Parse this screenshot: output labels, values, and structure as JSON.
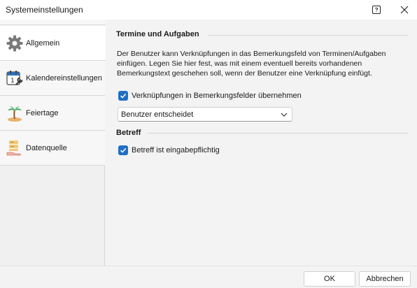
{
  "window": {
    "title": "Systemeinstellungen",
    "help_icon": "help-icon",
    "close_icon": "close-icon"
  },
  "sidebar": {
    "items": [
      {
        "label": "Allgemein",
        "icon": "gear-icon",
        "active": true
      },
      {
        "label": "Kalendereinstellungen",
        "icon": "calendar-wrench-icon",
        "active": false
      },
      {
        "label": "Feiertage",
        "icon": "palm-island-icon",
        "active": false
      },
      {
        "label": "Datenquelle",
        "icon": "database-hand-icon",
        "active": false
      }
    ]
  },
  "main": {
    "section1": {
      "title": "Termine und Aufgaben",
      "description_lines": [
        "Der Benutzer kann Verknüpfungen in das Bemerkungsfeld von Terminen/Aufgaben",
        "einfügen. Legen Sie hier fest, was mit einem eventuell bereits vorhandenen",
        "Bemerkungstext geschehen soll, wenn der Benutzer eine Verknüpfung einfügt."
      ],
      "checkbox_label": "Verknüpfungen in Bemerkungsfelder übernehmen",
      "checkbox_checked": true,
      "dropdown_value": "Benutzer entscheidet"
    },
    "section2": {
      "title": "Betreff",
      "checkbox_label": "Betreff ist eingabepflichtig",
      "checkbox_checked": true
    }
  },
  "footer": {
    "ok_label": "OK",
    "cancel_label": "Abbrechen"
  },
  "colors": {
    "accent": "#1f6fc5",
    "window_bg": "#f3f3f3",
    "sidebar_bg": "#f0f0f0"
  }
}
